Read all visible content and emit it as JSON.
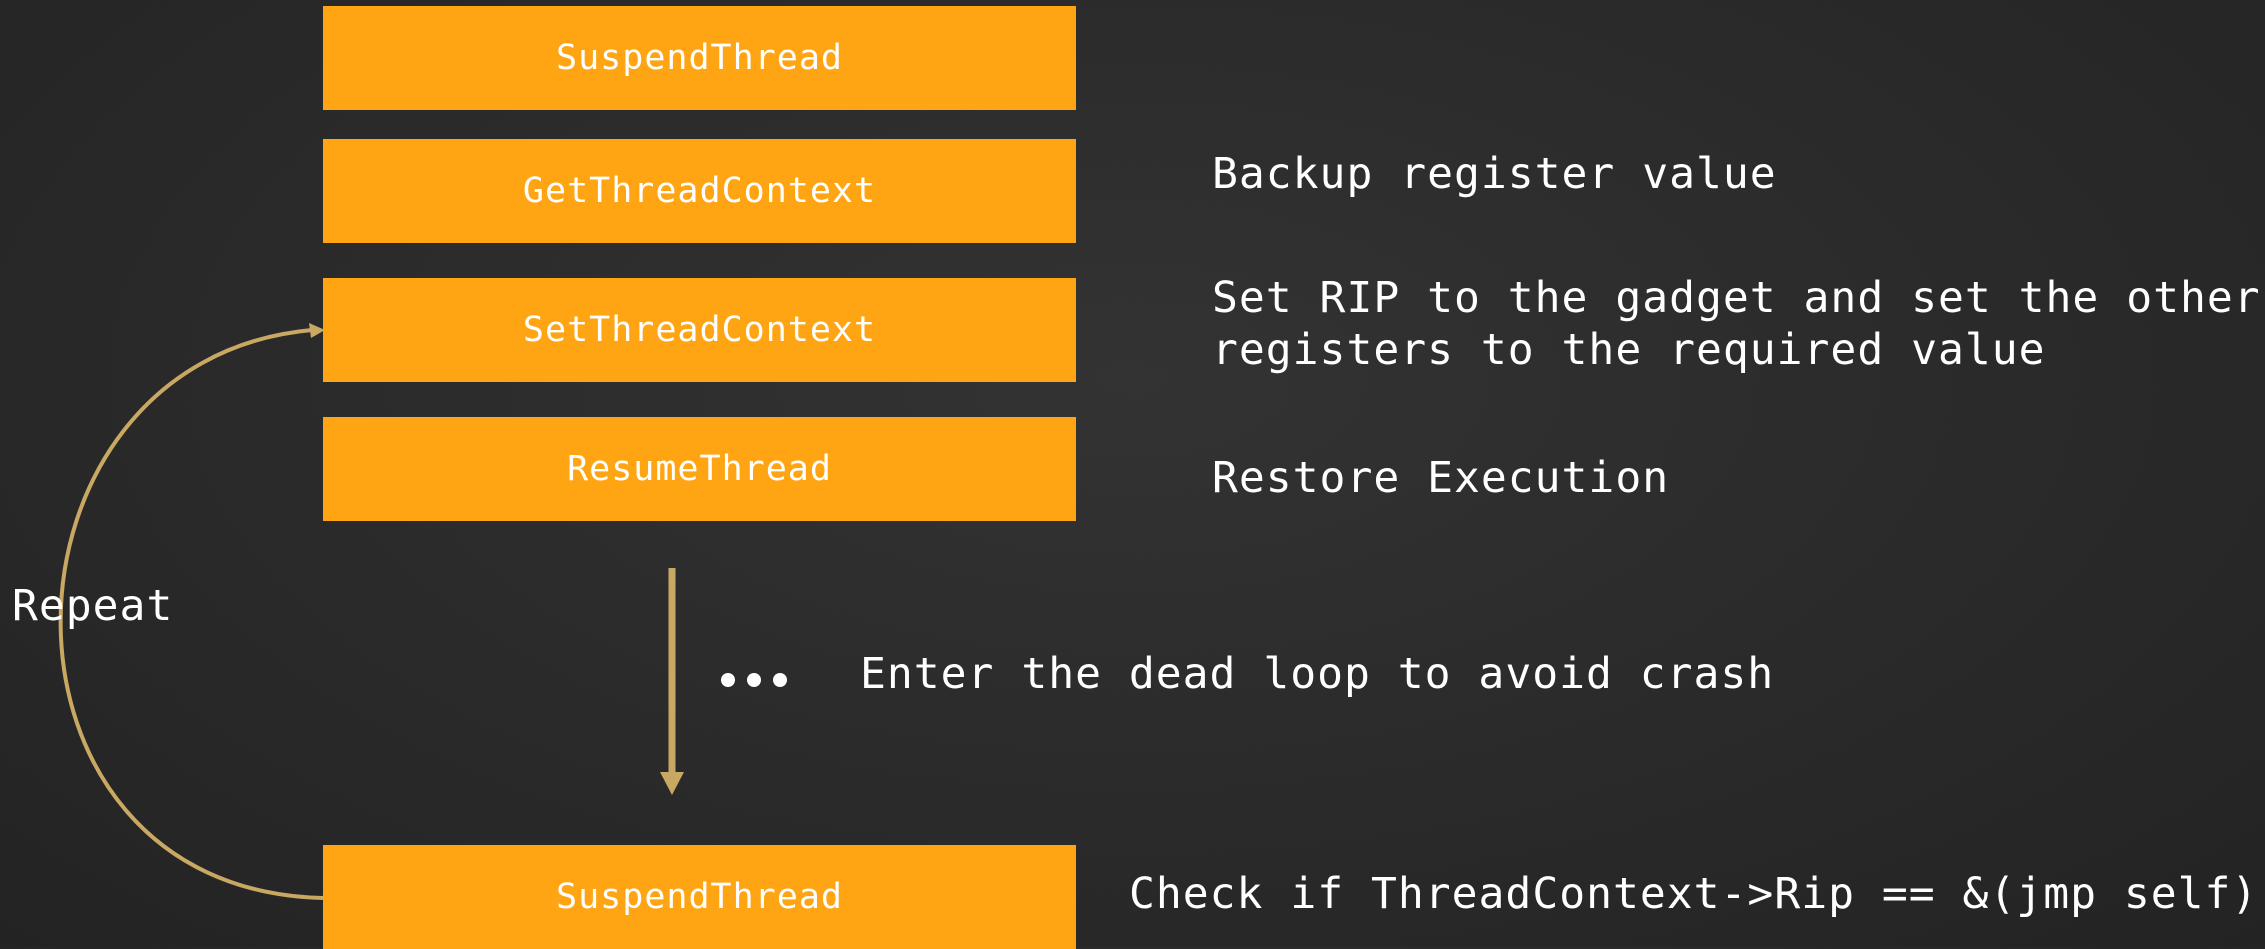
{
  "colors": {
    "box_fill": "#FFA514",
    "arrow": "#C8A862",
    "text": "#ffffff",
    "background": "#2c2c2c"
  },
  "steps": [
    {
      "label": "SuspendThread"
    },
    {
      "label": "GetThreadContext"
    },
    {
      "label": "SetThreadContext"
    },
    {
      "label": "ResumeThread"
    },
    {
      "label": "SuspendThread"
    }
  ],
  "notes": {
    "backup": "Backup register value",
    "set_rip_line1": "Set RIP to the gadget and set the other",
    "set_rip_line2": "registers to the required value",
    "restore": "Restore Execution",
    "dead_loop": "Enter the dead loop to avoid crash",
    "check": "Check if ThreadContext->Rip == &(jmp self)"
  },
  "loop_label": "Repeat",
  "ellipsis_icon": "three-dots-icon"
}
